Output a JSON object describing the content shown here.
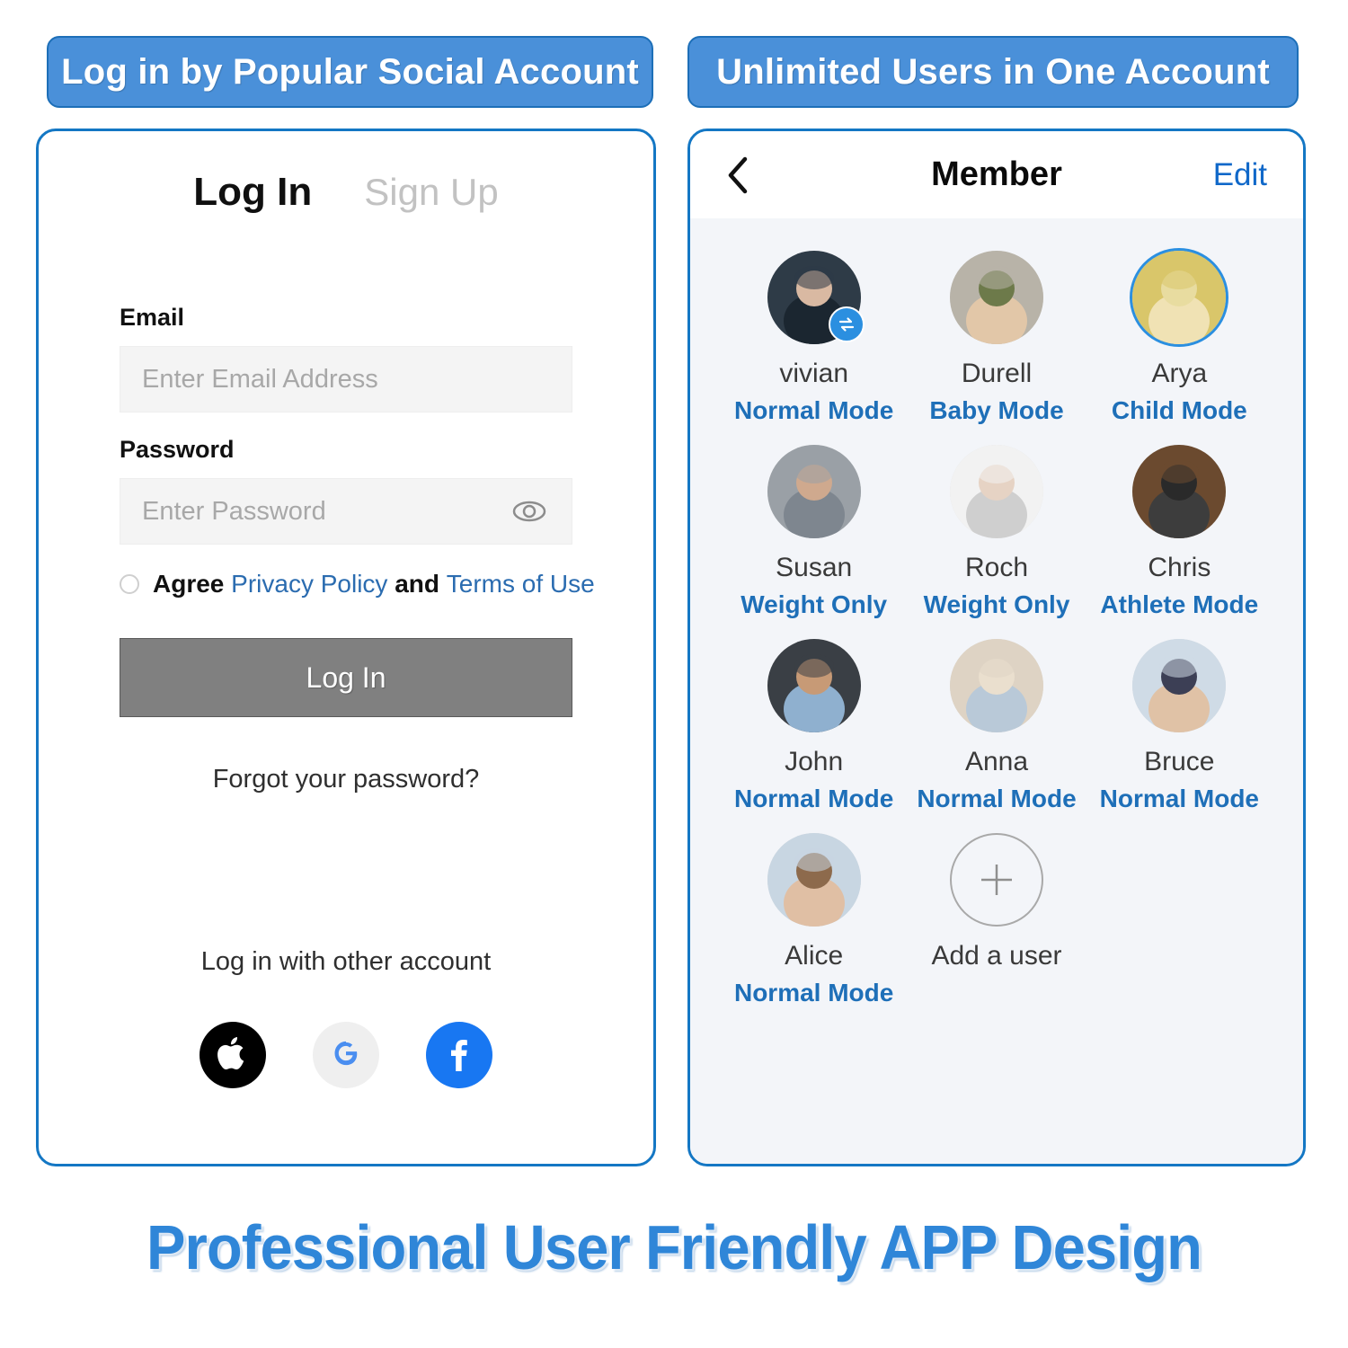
{
  "banners": {
    "left": "Log in by Popular Social Account",
    "right": "Unlimited Users in One Account"
  },
  "login": {
    "tab_active": "Log In",
    "tab_inactive": "Sign Up",
    "email_label": "Email",
    "email_placeholder": "Enter Email Address",
    "email_value": "",
    "password_label": "Password",
    "password_placeholder": "Enter Password",
    "password_value": "",
    "agree": {
      "prefix": "Agree ",
      "privacy_link": "Privacy Policy",
      "conjunction": " and ",
      "terms_link": "Terms of Use",
      "checked": false
    },
    "submit_label": "Log In",
    "forgot_label": "Forgot your password?",
    "other_account_label": "Log in with other account",
    "social": [
      {
        "name": "apple",
        "label": "Apple"
      },
      {
        "name": "google",
        "label": "Google"
      },
      {
        "name": "facebook",
        "label": "Facebook"
      }
    ]
  },
  "member": {
    "title": "Member",
    "edit_label": "Edit",
    "back_label": "Back",
    "add_user_label": "Add a user",
    "users": [
      {
        "name": "vivian",
        "mode": "Normal Mode",
        "badge": "swap",
        "ring": false
      },
      {
        "name": "Durell",
        "mode": "Baby Mode",
        "badge": "",
        "ring": false
      },
      {
        "name": "Arya",
        "mode": "Child Mode",
        "badge": "",
        "ring": true
      },
      {
        "name": "Susan",
        "mode": "Weight Only",
        "badge": "",
        "ring": false
      },
      {
        "name": "Roch",
        "mode": "Weight Only",
        "badge": "",
        "ring": false
      },
      {
        "name": "Chris",
        "mode": "Athlete Mode",
        "badge": "",
        "ring": false
      },
      {
        "name": "John",
        "mode": "Normal Mode",
        "badge": "",
        "ring": false
      },
      {
        "name": "Anna",
        "mode": "Normal Mode",
        "badge": "",
        "ring": false
      },
      {
        "name": "Bruce",
        "mode": "Normal Mode",
        "badge": "",
        "ring": false
      },
      {
        "name": "Alice",
        "mode": "Normal Mode",
        "badge": "",
        "ring": false
      }
    ]
  },
  "footer": {
    "caption": "Professional User  Friendly APP Design"
  },
  "colors": {
    "accent_blue": "#4a90d9",
    "border_blue": "#1477c4",
    "link_blue": "#1e6fb8",
    "button_gray": "#808080",
    "panel_bg": "#f3f5f9"
  }
}
